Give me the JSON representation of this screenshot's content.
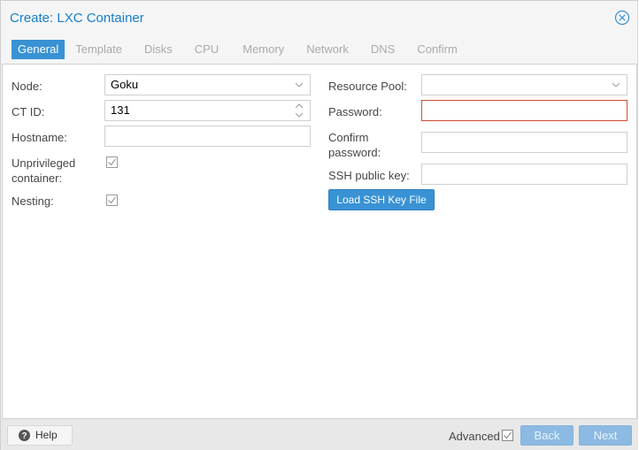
{
  "dialog": {
    "title": "Create: LXC Container",
    "close_icon": "close-circle-icon"
  },
  "tabs": [
    {
      "label": "General",
      "active": true
    },
    {
      "label": "Template",
      "active": false
    },
    {
      "label": "Disks",
      "active": false
    },
    {
      "label": "CPU",
      "active": false
    },
    {
      "label": "Memory",
      "active": false
    },
    {
      "label": "Network",
      "active": false
    },
    {
      "label": "DNS",
      "active": false
    },
    {
      "label": "Confirm",
      "active": false
    }
  ],
  "form": {
    "left": {
      "node": {
        "label": "Node:",
        "value": "Goku"
      },
      "ctid": {
        "label": "CT ID:",
        "value": "131"
      },
      "hostname": {
        "label": "Hostname:",
        "value": ""
      },
      "unprivileged": {
        "label_line1": "Unprivileged",
        "label_line2": "container:",
        "checked": true
      },
      "nesting": {
        "label": "Nesting:",
        "checked": true
      }
    },
    "right": {
      "resource_pool": {
        "label": "Resource Pool:",
        "value": ""
      },
      "password": {
        "label": "Password:",
        "value": ""
      },
      "confirm_password": {
        "label_line1": "Confirm",
        "label_line2": "password:",
        "value": ""
      },
      "ssh_key": {
        "label": "SSH public key:",
        "value": ""
      },
      "load_ssh_button": "Load SSH Key File"
    }
  },
  "footer": {
    "help_label": "Help",
    "advanced_label": "Advanced",
    "advanced_checked": true,
    "back_label": "Back",
    "next_label": "Next"
  },
  "colors": {
    "accent": "#3892d4",
    "title": "#157fcc",
    "invalid_border": "#cf4c35"
  }
}
